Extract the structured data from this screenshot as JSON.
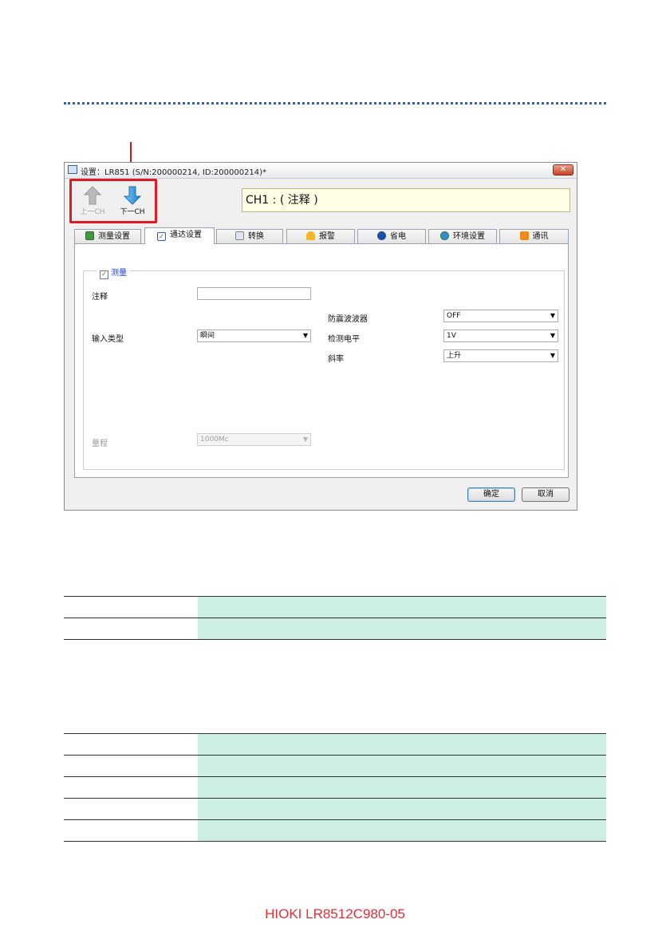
{
  "window": {
    "title": "设置：LR851  (S/N:200000214, ID:200000214)*",
    "close_glyph": "✕",
    "nav": {
      "prev_label": "上一CH",
      "next_label": "下一CH"
    },
    "channel_name": "CH1 : ( 注释 )"
  },
  "tabs": [
    {
      "label": "测量设置",
      "icon": "measure-icon"
    },
    {
      "label": "通达设置",
      "icon": "check-settings-icon"
    },
    {
      "label": "转换",
      "icon": "calculator-icon"
    },
    {
      "label": "报警",
      "icon": "bell-icon"
    },
    {
      "label": "省电",
      "icon": "bluetooth-icon"
    },
    {
      "label": "环境设置",
      "icon": "globe-icon"
    },
    {
      "label": "通讯",
      "icon": "rss-icon"
    }
  ],
  "active_tab": 1,
  "group": {
    "checked": true,
    "check_glyph": "✓",
    "label": "测量"
  },
  "form": {
    "comment_label": "注释",
    "comment_value": "",
    "input_type_label": "输入类型",
    "input_type_value": "瞬间",
    "antichatter_label": "防震波波器",
    "antichatter_value": "OFF",
    "detect_level_label": "检测电平",
    "detect_level_value": "1V",
    "slope_label": "斜率",
    "slope_value": "上升",
    "range_label": "量程",
    "range_value": "1000Mc",
    "dropdown_arrow": "▼"
  },
  "buttons": {
    "ok": "确定",
    "cancel": "取消"
  },
  "footer": "HIOKI LR8512C980-05",
  "colors": {
    "accent_dotline": "#2b63b8",
    "highlight_red": "#e01b23",
    "table_fill": "#cdeee2",
    "footer": "#e2303a"
  }
}
